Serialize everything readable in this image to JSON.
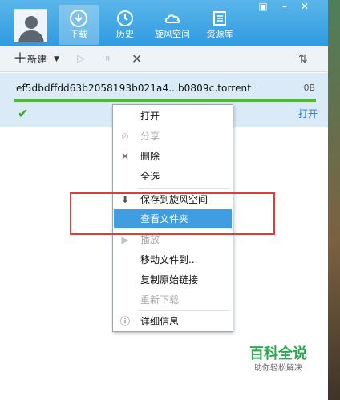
{
  "nav": {
    "tabs": [
      {
        "label": "下载",
        "icon": "download-icon",
        "active": true
      },
      {
        "label": "历史",
        "icon": "clock-icon"
      },
      {
        "label": "旋风空间",
        "icon": "cloud-icon"
      },
      {
        "label": "资源库",
        "icon": "list-icon"
      }
    ]
  },
  "toolbar": {
    "new_label": "新建",
    "icons": [
      "plus-icon",
      "dropdown-arrow-icon",
      "play-icon",
      "pause-icon",
      "delete-icon",
      "sort-icon"
    ]
  },
  "task": {
    "name": "ef5dbdffdd63b2058193b021a4...b0809c.torrent",
    "size": "0B",
    "progress": 1.0,
    "open_label": "打开"
  },
  "context_menu": {
    "items": [
      {
        "label": "打开"
      },
      {
        "label": "分享",
        "disabled": true
      },
      {
        "label": "删除"
      },
      {
        "label": "全选"
      },
      {
        "label": "保存到旋风空间"
      },
      {
        "label": "查看文件夹",
        "highlighted": true
      },
      {
        "label": "播放",
        "disabled": true
      },
      {
        "label": "移动文件到..."
      },
      {
        "label": "复制原始链接"
      },
      {
        "label": "重新下载",
        "disabled": true
      },
      {
        "label": "详细信息"
      }
    ]
  },
  "watermark": {
    "title": "百科全说",
    "subtitle": "助你轻松解决"
  },
  "colors": {
    "header_blue": "#3aa3e6",
    "highlight_blue": "#3f9de0",
    "progress_green": "#53b838",
    "annotation_red": "#e23b3b"
  }
}
